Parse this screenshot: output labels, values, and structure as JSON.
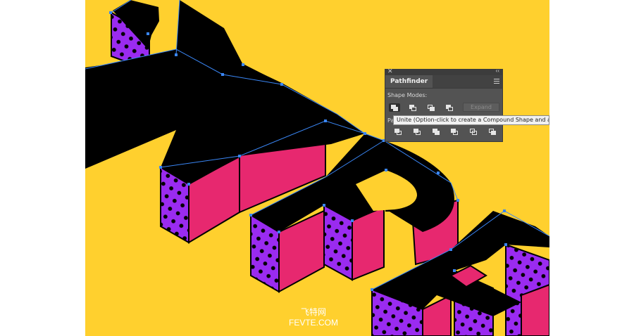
{
  "artwork": {
    "text": "TYPE",
    "colors": {
      "background": "#FFD02E",
      "face": "#000000",
      "extrusion": "#E7286F",
      "pattern_bg": "#9A2BF0",
      "pattern_dot": "#000000",
      "anchor": "#3A86F5"
    }
  },
  "pathfinder_panel": {
    "close_icon": "close-icon",
    "collapse_icon": "collapse-icon",
    "tab_label": "Pathfinder",
    "menu_icon": "panel-menu-icon",
    "shape_modes_label": "Shape Modes:",
    "shape_modes": [
      "Unite",
      "Minus Front",
      "Intersect",
      "Exclude"
    ],
    "expand_label": "Expand",
    "pathfinders_label": "Pa",
    "pathfinders": [
      "Divide",
      "Trim",
      "Merge",
      "Crop",
      "Outline",
      "Minus Back"
    ]
  },
  "tooltip": {
    "text": "Unite (Option-click to create a Compound Shape and add t"
  },
  "watermark": {
    "line1": "飞特网",
    "line2": "FEVTE.COM"
  }
}
